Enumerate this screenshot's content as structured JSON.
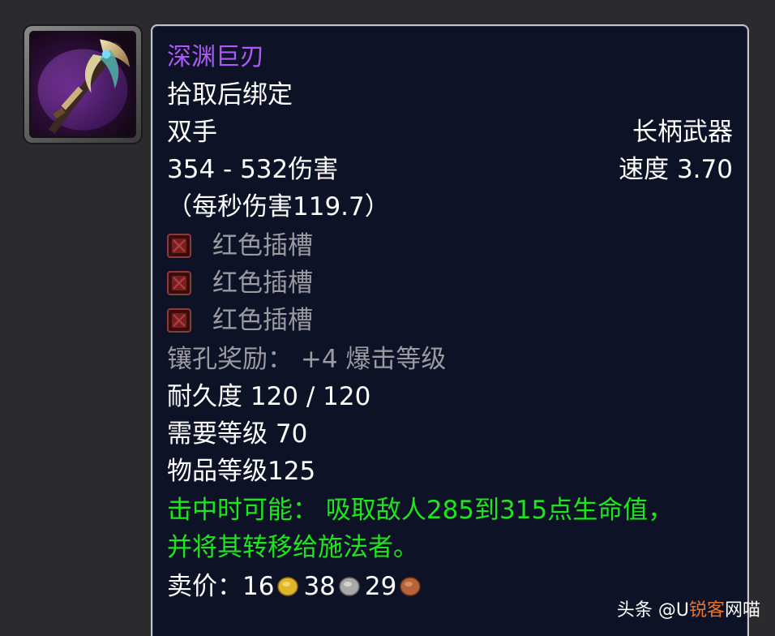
{
  "item": {
    "name": "深渊巨刃",
    "binding": "拾取后绑定",
    "slot": "双手",
    "type": "长柄武器",
    "damage": "354 - 532伤害",
    "speed": "速度 3.70",
    "dps": "（每秒伤害119.7）",
    "sockets": [
      {
        "label": "红色插槽",
        "icon": "red-socket-icon",
        "color": "#7a1f1f"
      },
      {
        "label": "红色插槽",
        "icon": "red-socket-icon",
        "color": "#7a1f1f"
      },
      {
        "label": "红色插槽",
        "icon": "red-socket-icon",
        "color": "#7a1f1f"
      }
    ],
    "socket_bonus": "镶孔奖励：  +4 爆击等级",
    "durability": "耐久度 120 / 120",
    "required_level": "需要等级 70",
    "item_level": "物品等级125",
    "effect_line1": "击中时可能：  吸取敌人285到315点生命值，",
    "effect_line2": "并将其转移给施法者。",
    "sell_label": "卖价：",
    "sell_gold": "16",
    "sell_silver": "38",
    "sell_copper": "29"
  },
  "colors": {
    "item_name": "#a95bf5",
    "effect": "#1ee51e",
    "disabled": "#9a9aa0",
    "tooltip_bg": "#0e1226",
    "gold": "#e2b62b",
    "silver": "#a9a9a9",
    "copper": "#b8643a"
  },
  "watermark": {
    "prefix": "头条 @U",
    "accent": "锐客",
    "suffix": "网喵"
  }
}
